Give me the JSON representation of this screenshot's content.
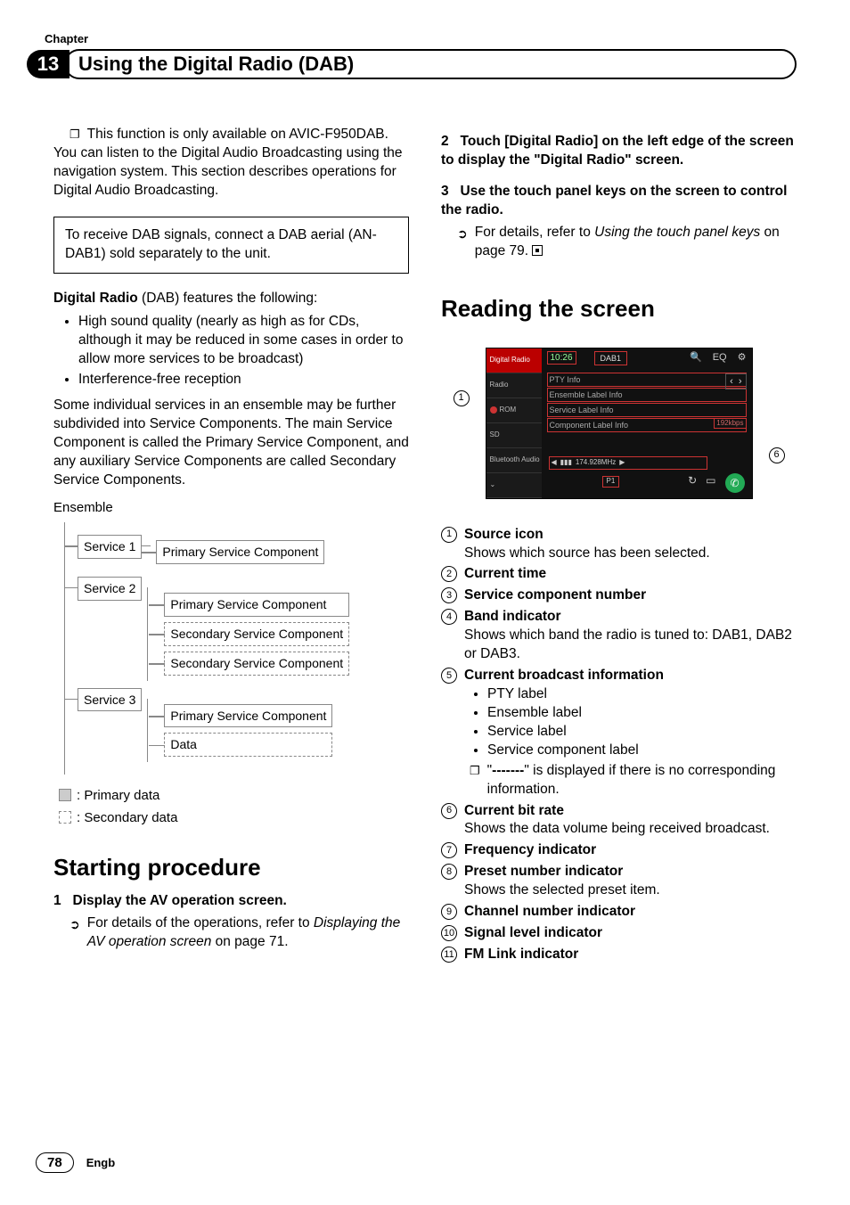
{
  "header": {
    "chapter_label": "Chapter",
    "chapter_number": "13",
    "title": "Using the Digital Radio (DAB)"
  },
  "left": {
    "availability_note": "This function is only available on AVIC-F950DAB.",
    "intro": "You can listen to the Digital Audio Broadcasting using the navigation system. This section describes operations for Digital Audio Broadcasting.",
    "aerial_box": "To receive DAB signals, connect a DAB aerial (AN-DAB1) sold separately to the unit.",
    "features_lead_bold": "Digital Radio",
    "features_lead_rest": " (DAB) features the following:",
    "features": [
      "High sound quality (nearly as high as for CDs, although it may be reduced in some cases in order to allow more services to be broadcast)",
      "Interference-free reception"
    ],
    "ensemble_para": "Some individual services in an ensemble may be further subdivided into Service Components. The main Service Component is called the Primary Service Component, and any auxiliary Service Components are called Secondary Service Components.",
    "ensemble_label": "Ensemble",
    "tree": {
      "s1": "Service 1",
      "s2": "Service 2",
      "s3": "Service 3",
      "primary": "Primary Service Component",
      "secondary": "Secondary Service Component",
      "data": "Data"
    },
    "legend_primary": ": Primary data",
    "legend_secondary": ": Secondary data",
    "starting_heading": "Starting procedure",
    "step1_num": "1",
    "step1_title": "Display the AV operation screen.",
    "step1_ref_a": "For details of the operations, refer to ",
    "step1_ref_ital": "Displaying the AV operation screen",
    "step1_ref_b": " on page 71."
  },
  "right": {
    "step2_num": "2",
    "step2_text": "Touch [Digital Radio] on the left edge of the screen to display the \"Digital Radio\" screen.",
    "step3_num": "3",
    "step3_text": "Use the touch panel keys on the screen to control the radio.",
    "step3_ref_a": "For details, refer to ",
    "step3_ref_ital": "Using the touch panel keys",
    "step3_ref_b": " on page 79.",
    "reading_heading": "Reading the screen",
    "shot_labels": {
      "digital_radio": "Digital Radio",
      "radio": "Radio",
      "rom": "ROM",
      "sd": "SD",
      "bt": "Bluetooth Audio",
      "time": "10:26",
      "band": "DAB1",
      "pty": "PTY Info",
      "ens": "Ensemble Label Info",
      "svc": "Service Label Info",
      "comp": "Component Label Info",
      "bitrate": "192kbps",
      "freq": "174.928MHz",
      "preset": "P1"
    },
    "callouts": [
      "1",
      "2",
      "3",
      "4",
      "5",
      "6",
      "7",
      "8",
      "9",
      "10",
      "11"
    ],
    "items": {
      "i1": {
        "title": "Source icon",
        "desc": "Shows which source has been selected."
      },
      "i2": {
        "title": "Current time"
      },
      "i3": {
        "title": "Service component number"
      },
      "i4": {
        "title": "Band indicator",
        "desc": "Shows which band the radio is tuned to: DAB1, DAB2 or DAB3."
      },
      "i5": {
        "title": "Current broadcast information",
        "bullets": [
          "PTY label",
          "Ensemble label",
          "Service label",
          "Service component label"
        ],
        "dash_note_a": "\"",
        "dash_note_b": "-------",
        "dash_note_c": "\" is displayed if there is no corresponding information."
      },
      "i6": {
        "title": "Current bit rate",
        "desc": "Shows the data volume being received broadcast."
      },
      "i7": {
        "title": "Frequency indicator"
      },
      "i8": {
        "title": "Preset number indicator",
        "desc": "Shows the selected preset item."
      },
      "i9": {
        "title": "Channel number indicator"
      },
      "i10": {
        "title": "Signal level indicator"
      },
      "i11": {
        "title": "FM Link indicator"
      }
    }
  },
  "footer": {
    "page": "78",
    "lang": "Engb"
  }
}
